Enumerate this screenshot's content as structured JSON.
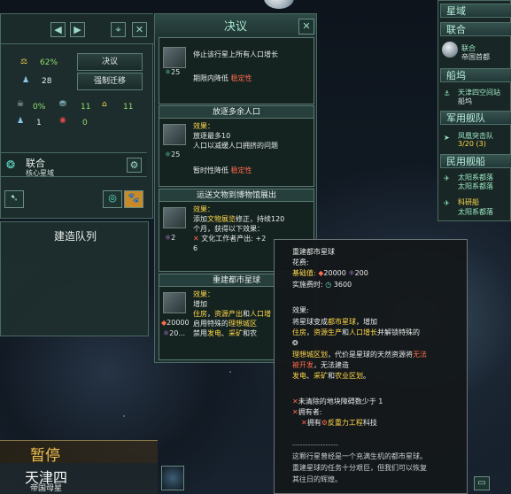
{
  "planet_panel": {
    "stability": "62%",
    "pops": "28",
    "btn_decisions": "决议",
    "btn_resettle": "强制迁移",
    "crime": "0%",
    "amenities": "11",
    "housing": "11",
    "unemployed": "1",
    "deviancy": "0",
    "sector_name": "联合",
    "sector_sub": "核心星域"
  },
  "queue": {
    "title": "建造队列"
  },
  "decisions": {
    "title": "决议",
    "cards": [
      {
        "title": "",
        "cost": "25",
        "line1": "停止该行星上所有",
        "line1_tail": "人口增长",
        "line2": "期限内降低",
        "line2_tail": "稳定性"
      },
      {
        "title": "放逐多余人口",
        "cost": "25",
        "label": "效果：",
        "line1": "放逐最多10",
        "line2": "人口以减缓人口拥挤的问题",
        "line3": "暂时性降低",
        "line3_tail": "稳定性"
      },
      {
        "title": "运送文物到博物馆展出",
        "cost": "2",
        "label": "效果：",
        "line1": "添加",
        "line1_hl": "文物展览",
        "line1_tail": "修正，持续120",
        "line2": "个月，获得以下效果：",
        "line3": "文化工作者产出: +2",
        "line4": "6"
      },
      {
        "title": "重建都市星球",
        "cost1": "20000",
        "cost2": "20...",
        "label": "效果：",
        "line1": "增加",
        "line2a": "住房",
        "line2b": "，",
        "line2c": "资源产出",
        "line2d": "和",
        "line2e": "人口增",
        "line3a": "启用特殊的",
        "line3b": "理想城区",
        "line4a": "禁用",
        "line4b": "发电",
        "line4c": "、",
        "line4d": "采矿",
        "line4e": "和农"
      }
    ]
  },
  "outliner": {
    "sec_sectors": "星域",
    "sec_union": "联合",
    "union_item": "联合",
    "union_item_sub": "帝国首都",
    "sec_shipyards": "船坞",
    "shipyard_item": "天津四空间站",
    "shipyard_sub": "船坞",
    "sec_military": "军用舰队",
    "fleet_name": "凤凰突击队",
    "fleet_count": "3/20",
    "fleet_extra": "(3)",
    "sec_civilian": "民用舰船",
    "civ1": "太阳系都落",
    "civ2": "太阳系都落",
    "civ3": "科研船",
    "civ4": "太阳系都落"
  },
  "tooltip": {
    "title": "重建都市星球",
    "cost_label": "花费:",
    "base_label": "基础值:",
    "base_alloys": "20000",
    "base_influence": "200",
    "actual_label": "实施费时:",
    "actual_time": "3600",
    "effect_label": "效果:",
    "e1": "将星球变成",
    "e1b": "都市星球",
    "e1c": "，增加",
    "e2a": "住房",
    "e2b": "，",
    "e2c": "资源生产",
    "e2d": "和",
    "e2e": "人口增长",
    "e2f": "并解锁特殊的",
    "e4": "理想城区划",
    "e4b": "，代价是星球的天然资源将",
    "e4c": "无法",
    "e5a": "被开发",
    "e5b": "，无法建造",
    "e6a": "发电",
    "e6b": "、",
    "e6c": "采矿",
    "e6d": "和",
    "e6e": "农业区划",
    "e6f": "。",
    "req1": "未清除的地块障碍数少于 1",
    "req2": "拥有者:",
    "req3": "拥有",
    "req3b": "反重力工程",
    "req3c": "科技",
    "divider": "------------------",
    "desc1": "这颗行星曾经是一个充满生机的都市星球。",
    "desc2": "重建星球的任务十分艰巨，但我们可以恢复",
    "desc3": "其往日的辉煌。"
  },
  "bottom": {
    "pause": "暂停",
    "planet_name": "天津四",
    "planet_sub": "帝国母星"
  },
  "colors": {
    "panel_bg": "#1f2e2e",
    "accent": "#a8e6cf",
    "highlight_yellow": "#ffd84a",
    "negative_red": "#ff6a4a",
    "positive_green": "#8fe06a"
  }
}
